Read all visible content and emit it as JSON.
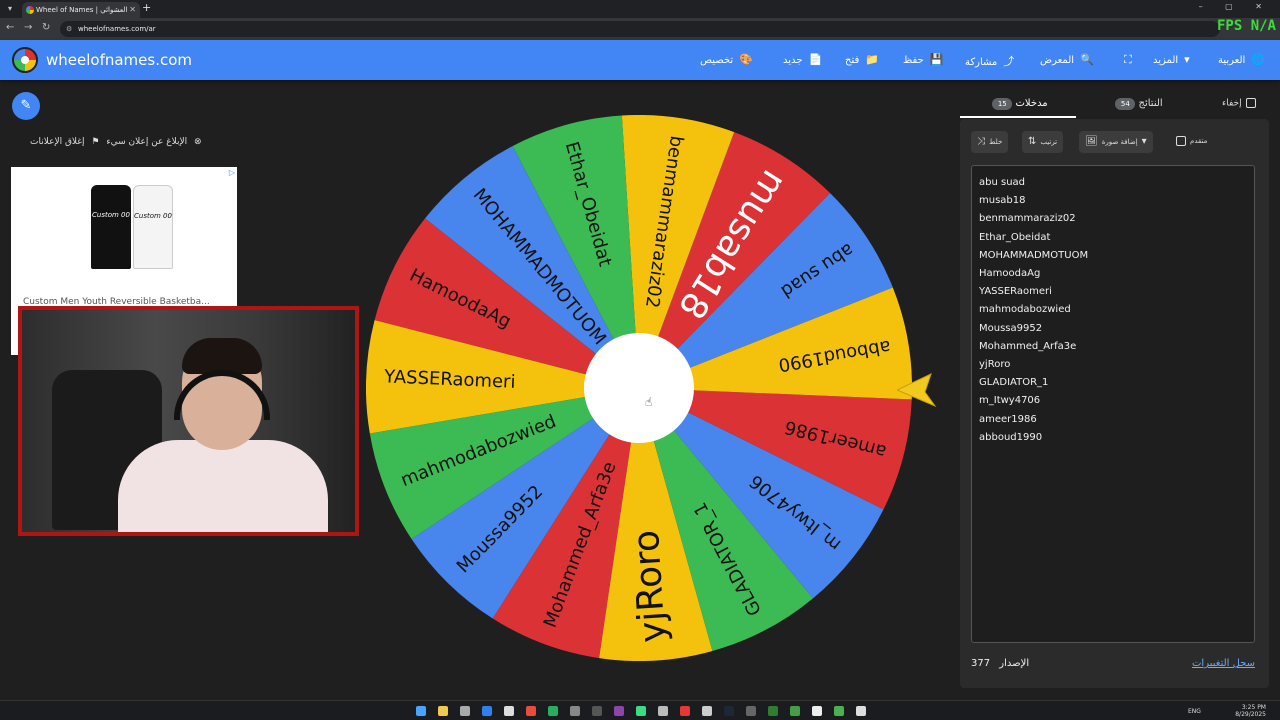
{
  "browser": {
    "tab_title": "Wheel of Names | العشوائي",
    "url": "wheelofnames.com/ar",
    "overlay_text": "FPS N/A"
  },
  "header": {
    "site_name": "wheelofnames.com",
    "menu": [
      {
        "label": "تخصيص",
        "icon": "palette-icon",
        "glyph": "🎨"
      },
      {
        "label": "جديد",
        "icon": "file-icon",
        "glyph": "📄"
      },
      {
        "label": "فتح",
        "icon": "folder-icon",
        "glyph": "📁"
      },
      {
        "label": "حفظ",
        "icon": "save-icon",
        "glyph": "💾"
      },
      {
        "label": "مشاركة",
        "icon": "share-icon",
        "glyph": "⤴"
      },
      {
        "label": "المعرض",
        "icon": "search-icon",
        "glyph": "🔍"
      },
      {
        "label": "",
        "icon": "fullscreen-icon",
        "glyph": "⛶"
      },
      {
        "label": "المزيد",
        "icon": "dropdown-icon",
        "glyph": "▾"
      },
      {
        "label": "العربية",
        "icon": "globe-icon",
        "glyph": "🌐"
      }
    ]
  },
  "ads": {
    "close_label": "إغلاق الإعلانات",
    "report_label": "الإبلاغ عن إعلان سيء",
    "ad_title": "Custom Men Youth Reversible Basketba...",
    "jersey_text": "Custom 00"
  },
  "wheel": {
    "segments": [
      {
        "label": "abu suad",
        "color": "#4885ed",
        "big": false
      },
      {
        "label": "musab18",
        "color": "#db3236",
        "big": true
      },
      {
        "label": "benmammaraziz02",
        "color": "#f4c20d",
        "big": false
      },
      {
        "label": "Ethar_Obeidat",
        "color": "#3cba54",
        "big": false
      },
      {
        "label": "MOHAMMADMOTUOM",
        "color": "#4885ed",
        "big": false
      },
      {
        "label": "HamoodaAg",
        "color": "#db3236",
        "big": false
      },
      {
        "label": "YASSERaomeri",
        "color": "#f4c20d",
        "big": false
      },
      {
        "label": "mahmodabozwied",
        "color": "#3cba54",
        "big": false
      },
      {
        "label": "Moussa9952",
        "color": "#4885ed",
        "big": false
      },
      {
        "label": "Mohammed_Arfa3e",
        "color": "#db3236",
        "big": false
      },
      {
        "label": "yjRoro",
        "color": "#f4c20d",
        "big": true
      },
      {
        "label": "GLADIATOR_1",
        "color": "#3cba54",
        "big": false
      },
      {
        "label": "m_Itwy4706",
        "color": "#4885ed",
        "big": false
      },
      {
        "label": "ameer1986",
        "color": "#db3236",
        "big": false
      },
      {
        "label": "abboud1990",
        "color": "#f4c20d",
        "big": false
      }
    ]
  },
  "panel": {
    "hide_label": "إخفاء",
    "tabs": {
      "entries_label": "مدخلات",
      "entries_count": "15",
      "results_label": "النتائج",
      "results_count": "54"
    },
    "toolbar": {
      "shuffle_label": "خلط",
      "sort_label": "ترتيب",
      "add_image_label": "إضافة صورة",
      "advanced_label": "متقدم"
    },
    "entries": [
      "abu suad",
      "musab18",
      "benmammaraziz02",
      "Ethar_Obeidat",
      "MOHAMMADMOTUOM",
      "HamoodaAg",
      "YASSERaomeri",
      "mahmodabozwied",
      "Moussa9952",
      "Mohammed_Arfa3e",
      "yjRoro",
      "GLADIATOR_1",
      "m_Itwy4706",
      "ameer1986",
      "abboud1990"
    ],
    "version_label": "الإصدار",
    "version_number": "377",
    "changelog_label": "سجل التغييرات"
  },
  "taskbar": {
    "lang": "ENG",
    "time": "3:25 PM",
    "date": "8/29/2025"
  }
}
